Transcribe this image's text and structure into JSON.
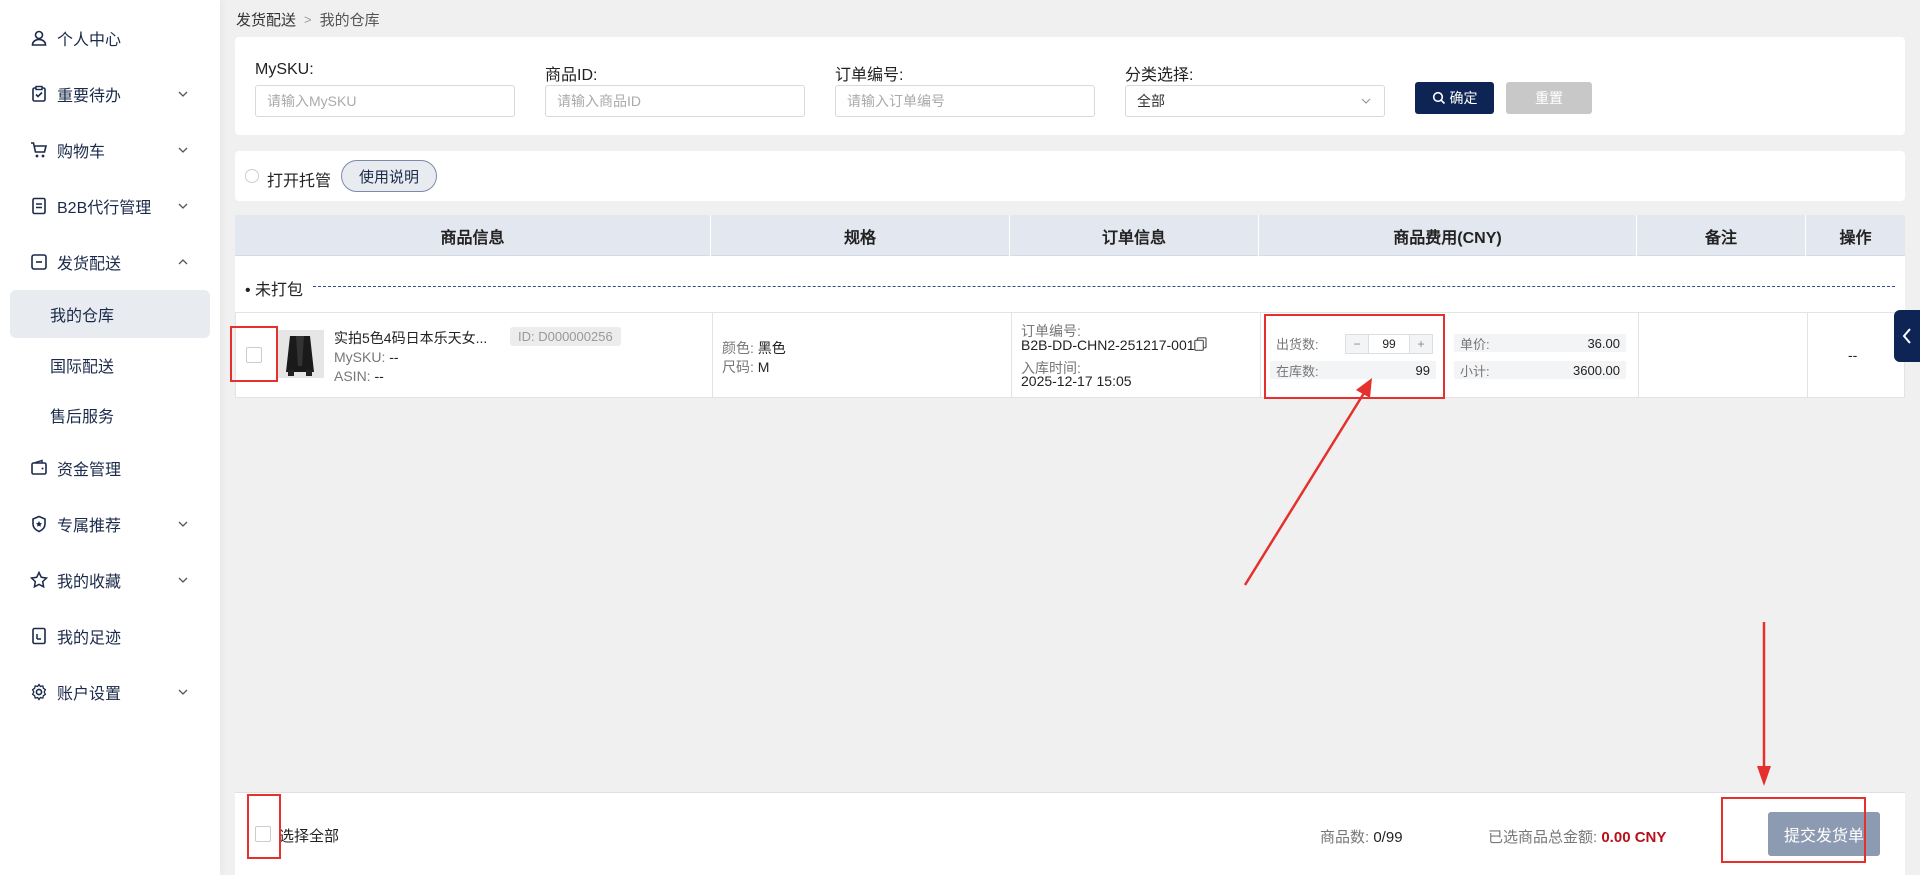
{
  "sidebar": {
    "items": [
      {
        "label": "个人中心",
        "icon": "user-icon",
        "expandable": false
      },
      {
        "label": "重要待办",
        "icon": "clipboard-check-icon",
        "expandable": true
      },
      {
        "label": "购物车",
        "icon": "cart-icon",
        "expandable": true
      },
      {
        "label": "B2B代行管理",
        "icon": "document-icon",
        "expandable": true
      },
      {
        "label": "发货配送",
        "icon": "box-icon",
        "expandable": true,
        "expanded": true
      },
      {
        "label": "资金管理",
        "icon": "wallet-icon",
        "expandable": false
      },
      {
        "label": "专属推荐",
        "icon": "shield-star-icon",
        "expandable": true
      },
      {
        "label": "我的收藏",
        "icon": "star-icon",
        "expandable": true
      },
      {
        "label": "我的足迹",
        "icon": "footprint-icon",
        "expandable": false
      },
      {
        "label": "账户设置",
        "icon": "gear-icon",
        "expandable": true
      }
    ],
    "subitems": [
      {
        "label": "我的仓库",
        "active": true
      },
      {
        "label": "国际配送",
        "active": false
      },
      {
        "label": "售后服务",
        "active": false
      }
    ]
  },
  "breadcrumb": {
    "parent": "发货配送",
    "current": "我的仓库"
  },
  "filter": {
    "mysku": {
      "label": "MySKU:",
      "placeholder": "请输入MySKU"
    },
    "product_id": {
      "label": "商品ID:",
      "placeholder": "请输入商品ID"
    },
    "order_no": {
      "label": "订单编号:",
      "placeholder": "请输入订单编号"
    },
    "category": {
      "label": "分类选择:",
      "value": "全部"
    },
    "confirm_label": "确定",
    "reset_label": "重置"
  },
  "toggle": {
    "label": "打开托管",
    "usage_label": "使用说明"
  },
  "table": {
    "headers": [
      "商品信息",
      "规格",
      "订单信息",
      "商品费用(CNY)",
      "备注",
      "操作"
    ],
    "group_label": "• 未打包",
    "row": {
      "name": "实拍5色4码日本乐天女...",
      "id": "ID: D000000256",
      "mysku_label": "MySKU:",
      "mysku_value": "--",
      "asin_label": "ASIN:",
      "asin_value": "--",
      "color_label": "颜色:",
      "color_value": "黑色",
      "size_label": "尺码:",
      "size_value": "M",
      "order_label": "订单编号:",
      "order_value": "B2B-DD-CHN2-251217-001",
      "stock_time_label": "入库时间:",
      "stock_time_value": "2025-12-17 15:05",
      "ship_qty_label": "出货数:",
      "ship_qty_value": "99",
      "stock_qty_label": "在库数:",
      "stock_qty_value": "99",
      "unit_price_label": "单价:",
      "unit_price_value": "36.00",
      "subtotal_label": "小计:",
      "subtotal_value": "3600.00",
      "remark": "",
      "action": "--"
    }
  },
  "footer": {
    "select_all_label": "选择全部",
    "count_label": "商品数:",
    "count_value": "0/99",
    "total_label": "已选商品总金额:",
    "total_value": "0.00",
    "total_currency": "CNY",
    "submit_label": "提交发货单"
  },
  "colors": {
    "primary": "#0d2454",
    "annotation": "#e5302d",
    "amount": "#b8101a",
    "submit": "#8d9bb2"
  }
}
